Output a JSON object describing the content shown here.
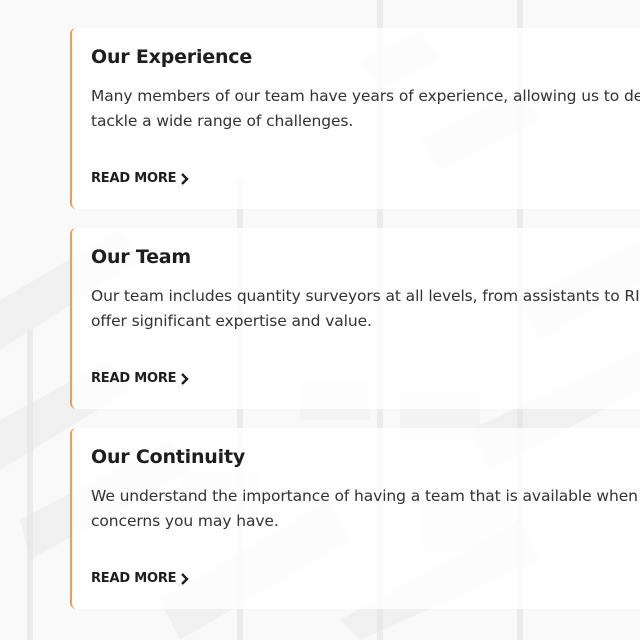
{
  "accent_color": "#f39c5a",
  "cards": [
    {
      "title": "Our Experience",
      "line1": "Many members of our team have years of experience, allowing us to de",
      "line2": "tackle a wide range of challenges.",
      "read_more": "READ MORE",
      "icon": "chevron-right-icon"
    },
    {
      "title": "Our Team",
      "line1": "Our team includes quantity surveyors at all levels, from assistants to RIC",
      "line2": "offer significant expertise and value.",
      "read_more": "READ MORE",
      "icon": "chevron-right-icon"
    },
    {
      "title": "Our Continuity",
      "line1": "We understand the importance of having a team that is available when",
      "line2": "concerns you may have.",
      "read_more": "READ MORE",
      "icon": "chevron-right-icon"
    }
  ]
}
